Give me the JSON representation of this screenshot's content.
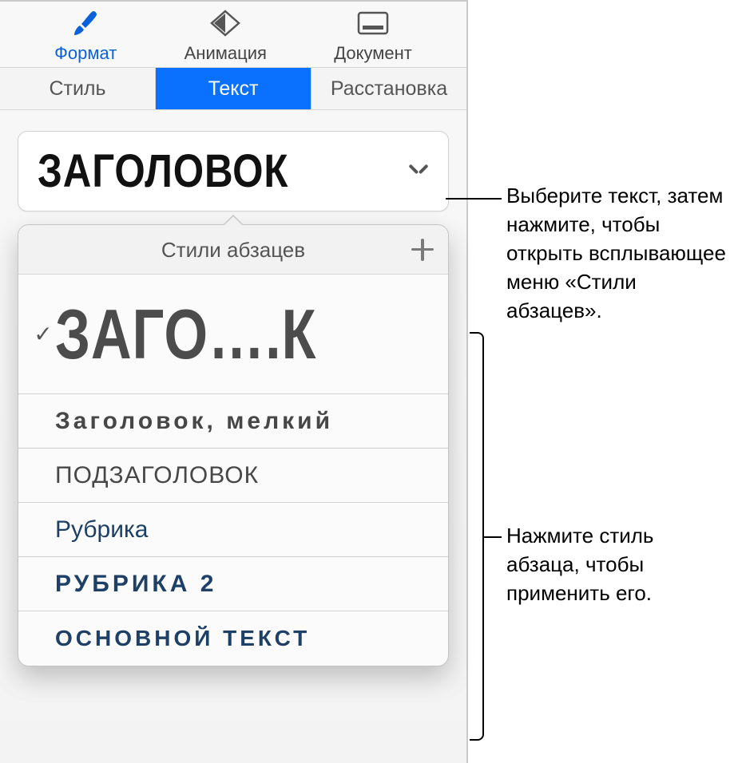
{
  "toolbar": {
    "format": "Формат",
    "animation": "Анимация",
    "document": "Документ"
  },
  "subtabs": {
    "style": "Стиль",
    "text": "Текст",
    "layout": "Расстановка"
  },
  "current_style": "ЗАГОЛОВОК",
  "popover_title": "Стили абзацев",
  "styles": [
    {
      "label": "ЗАГО….К",
      "checked": true
    },
    {
      "label": "Заголовок, мелкий",
      "checked": false
    },
    {
      "label": "ПОДЗАГОЛОВОК",
      "checked": false
    },
    {
      "label": "Рубрика",
      "checked": false
    },
    {
      "label": "РУБРИКА 2",
      "checked": false
    },
    {
      "label": "ОСНОВНОЙ ТЕКСТ",
      "checked": false
    }
  ],
  "callouts": {
    "top": "Выберите текст, затем нажмите, чтобы открыть всплывающее меню «Стили абзацев».",
    "bottom": "Нажмите стиль абзаца, чтобы применить его."
  }
}
